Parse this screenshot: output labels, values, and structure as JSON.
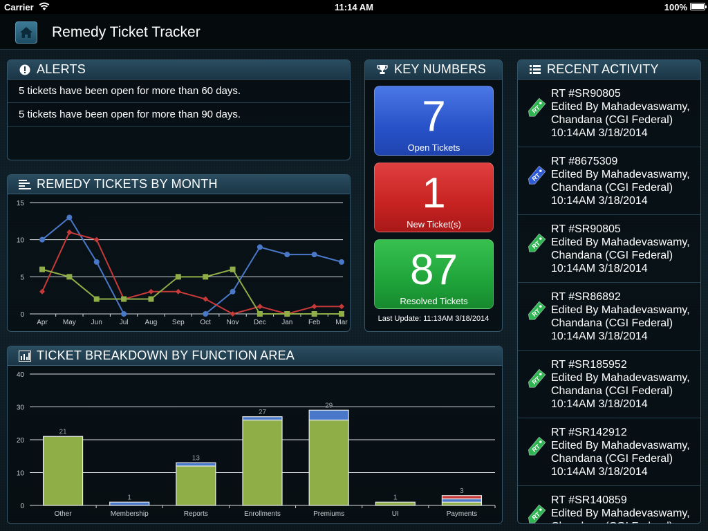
{
  "status_bar": {
    "carrier": "Carrier",
    "time": "11:14 AM",
    "battery": "100%"
  },
  "app": {
    "title": "Remedy Ticket Tracker"
  },
  "alerts": {
    "title": "ALERTS",
    "items": [
      "5 tickets have been open for more than 60 days.",
      "5 tickets have been open for more than 90 days."
    ]
  },
  "key_numbers": {
    "title": "KEY NUMBERS",
    "tiles": [
      {
        "value": "7",
        "label": "Open Tickets",
        "color": "#2f5cd6"
      },
      {
        "value": "1",
        "label": "New Ticket(s)",
        "color": "#d02a2a"
      },
      {
        "value": "87",
        "label": "Resolved Tickets",
        "color": "#22a83e"
      }
    ],
    "last_update": "Last Update: 11:13AM 3/18/2014"
  },
  "recent_activity": {
    "title": "RECENT ACTIVITY",
    "items": [
      {
        "ticket": "RT #SR90805",
        "line1": "Edited By Mahadevaswamy,",
        "line2": "Chandana (CGI Federal)",
        "time": "10:14AM 3/18/2014",
        "tag_color": "#2fb552",
        "tag_text": "RT"
      },
      {
        "ticket": "RT #8675309",
        "line1": "Edited By Mahadevaswamy,",
        "line2": "Chandana (CGI Federal)",
        "time": "10:14AM 3/18/2014",
        "tag_color": "#2f5cd6",
        "tag_text": "RT"
      },
      {
        "ticket": "RT #SR90805",
        "line1": "Edited By Mahadevaswamy,",
        "line2": "Chandana (CGI Federal)",
        "time": "10:14AM 3/18/2014",
        "tag_color": "#2fb552",
        "tag_text": "RT"
      },
      {
        "ticket": "RT #SR86892",
        "line1": "Edited By Mahadevaswamy,",
        "line2": "Chandana (CGI Federal)",
        "time": "10:14AM 3/18/2014",
        "tag_color": "#2fb552",
        "tag_text": "RT"
      },
      {
        "ticket": "RT #SR185952",
        "line1": "Edited By Mahadevaswamy,",
        "line2": "Chandana (CGI Federal)",
        "time": "10:14AM 3/18/2014",
        "tag_color": "#2fb552",
        "tag_text": "RT"
      },
      {
        "ticket": "RT #SR142912",
        "line1": "Edited By Mahadevaswamy,",
        "line2": "Chandana (CGI Federal)",
        "time": "10:14AM 3/18/2014",
        "tag_color": "#2fb552",
        "tag_text": "RT"
      },
      {
        "ticket": "RT #SR140859",
        "line1": "Edited By Mahadevaswamy,",
        "line2": "Chandana (CGI Federal)",
        "time": "",
        "tag_color": "#2fb552",
        "tag_text": "RT"
      }
    ]
  },
  "chart_data": [
    {
      "type": "line",
      "title": "REMEDY TICKETS BY MONTH",
      "categories": [
        "Apr",
        "May",
        "Jun",
        "Jul",
        "Aug",
        "Sep",
        "Oct",
        "Nov",
        "Dec",
        "Jan",
        "Feb",
        "Mar"
      ],
      "ylim": [
        0,
        15
      ],
      "yticks": [
        0,
        5,
        10,
        15
      ],
      "grid": true,
      "series": [
        {
          "color": "#4a78c8",
          "marker": "circle",
          "values": [
            10,
            13,
            7,
            0,
            null,
            null,
            0,
            3,
            9,
            8,
            8,
            7
          ]
        },
        {
          "color": "#c83a3a",
          "marker": "diamond",
          "values": [
            3,
            11,
            10,
            2,
            3,
            3,
            2,
            0,
            1,
            0,
            1,
            1
          ]
        },
        {
          "color": "#8fae48",
          "marker": "square",
          "values": [
            6,
            5,
            2,
            2,
            2,
            5,
            5,
            6,
            0,
            0,
            0,
            0
          ]
        }
      ]
    },
    {
      "type": "bar",
      "title": "TICKET BREAKDOWN BY FUNCTION AREA",
      "categories": [
        "Other",
        "Membership",
        "Reports",
        "Enrollments",
        "Premiums",
        "UI",
        "Payments"
      ],
      "totals": [
        21,
        1,
        13,
        27,
        29,
        1,
        3
      ],
      "ylim": [
        0,
        40
      ],
      "yticks": [
        0,
        10,
        20,
        30,
        40
      ],
      "grid": true,
      "series": [
        {
          "color": "#8fae48",
          "values": [
            21,
            0,
            12,
            26,
            26,
            1,
            1
          ]
        },
        {
          "color": "#4a78c8",
          "values": [
            0,
            1,
            1,
            1,
            3,
            0,
            1
          ]
        },
        {
          "color": "#c83a3a",
          "values": [
            0,
            0,
            0,
            0,
            0,
            0,
            1
          ]
        }
      ]
    }
  ]
}
